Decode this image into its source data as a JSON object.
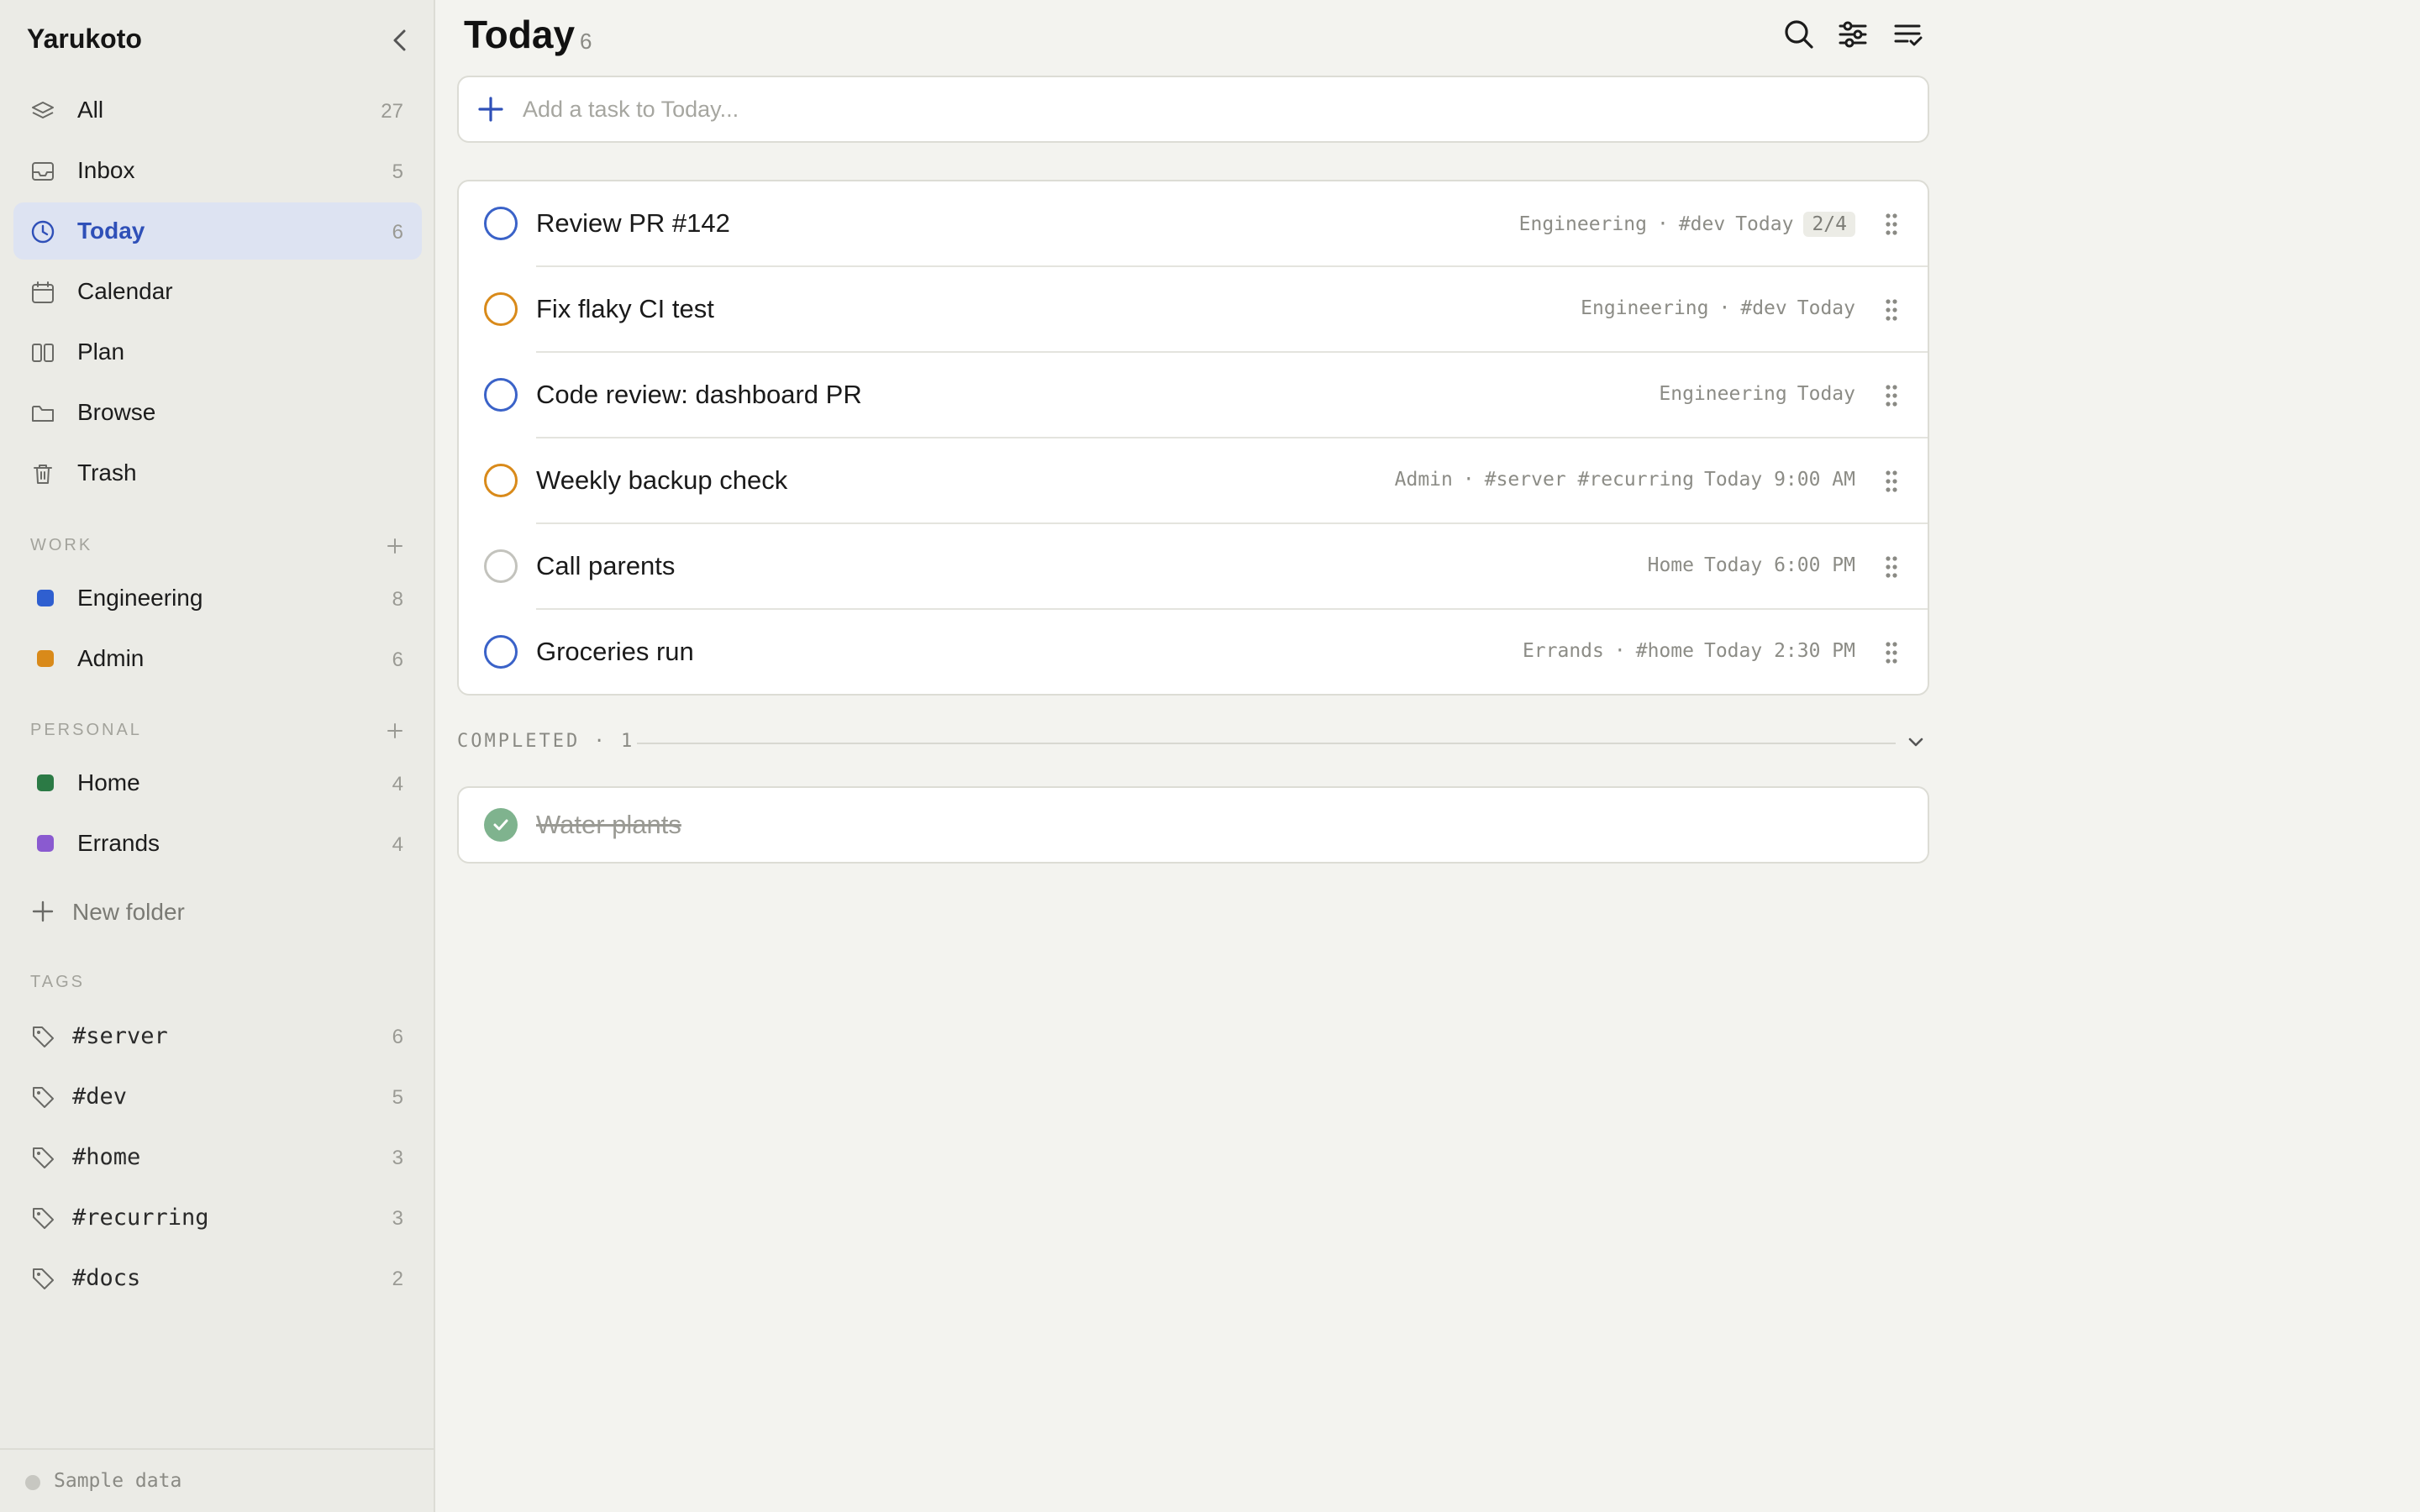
{
  "sidebar": {
    "app_title": "Yarukoto",
    "nav": [
      {
        "label": "All",
        "count": "27",
        "icon": "layers-icon"
      },
      {
        "label": "Inbox",
        "count": "5",
        "icon": "inbox-icon"
      },
      {
        "label": "Today",
        "count": "6",
        "icon": "clock-icon",
        "active": true
      },
      {
        "label": "Calendar",
        "count": "",
        "icon": "calendar-icon"
      },
      {
        "label": "Plan",
        "count": "",
        "icon": "columns-icon"
      },
      {
        "label": "Browse",
        "count": "",
        "icon": "folder-icon"
      },
      {
        "label": "Trash",
        "count": "",
        "icon": "trash-icon"
      }
    ],
    "sections": {
      "work": {
        "label": "WORK",
        "folders": [
          {
            "label": "Engineering",
            "count": "8",
            "color": "#2f5fd0"
          },
          {
            "label": "Admin",
            "count": "6",
            "color": "#d98a1a"
          }
        ]
      },
      "personal": {
        "label": "PERSONAL",
        "folders": [
          {
            "label": "Home",
            "count": "4",
            "color": "#2b7a45"
          },
          {
            "label": "Errands",
            "count": "4",
            "color": "#8a5ad0"
          }
        ]
      }
    },
    "new_folder_label": "New folder",
    "tags_label": "TAGS",
    "tags": [
      {
        "label": "#server",
        "count": "6"
      },
      {
        "label": "#dev",
        "count": "5"
      },
      {
        "label": "#home",
        "count": "3"
      },
      {
        "label": "#recurring",
        "count": "3"
      },
      {
        "label": "#docs",
        "count": "2"
      }
    ],
    "footer": "Sample data"
  },
  "main": {
    "title": "Today",
    "count": "6",
    "add_placeholder": "Add a task to Today...",
    "tasks": [
      {
        "title": "Review PR #142",
        "folder": "Engineering",
        "sep": "·",
        "tags": "#dev",
        "date": "Today",
        "subtasks": "2/4",
        "ring_color": "#3a62c8"
      },
      {
        "title": "Fix flaky CI test",
        "folder": "Engineering",
        "sep": "·",
        "tags": "#dev",
        "date": "Today",
        "subtasks": "",
        "ring_color": "#d98a1a"
      },
      {
        "title": "Code review: dashboard PR",
        "folder": "Engineering",
        "sep": "",
        "tags": "",
        "date": "Today",
        "subtasks": "",
        "ring_color": "#3a62c8"
      },
      {
        "title": "Weekly backup check",
        "folder": "Admin",
        "sep": "·",
        "tags": "#server #recurring",
        "date": "Today 9:00 AM",
        "subtasks": "",
        "ring_color": "#d98a1a"
      },
      {
        "title": "Call parents",
        "folder": "Home",
        "sep": "",
        "tags": "",
        "date": "Today 6:00 PM",
        "subtasks": "",
        "ring_color": "#c3c3bd"
      },
      {
        "title": "Groceries run",
        "folder": "Errands",
        "sep": "·",
        "tags": "#home",
        "date": "Today 2:30 PM",
        "subtasks": "",
        "ring_color": "#3a62c8"
      }
    ],
    "completed_label": "COMPLETED · 1",
    "completed": [
      {
        "title": "Water plants"
      }
    ]
  }
}
